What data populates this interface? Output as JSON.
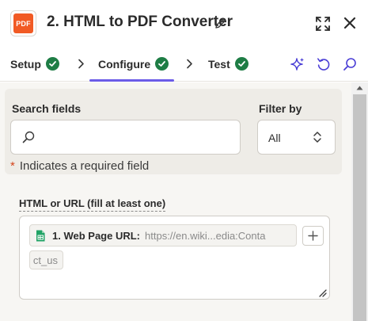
{
  "header": {
    "app_logo_text": "PDF",
    "title": "2. HTML to PDF Converter",
    "icons": [
      "edit-icon",
      "expand-icon",
      "close-icon"
    ]
  },
  "tabs": [
    {
      "label": "Setup",
      "status": "complete"
    },
    {
      "label": "Configure",
      "status": "complete",
      "active": true
    },
    {
      "label": "Test",
      "status": "complete"
    }
  ],
  "toolbar_icons": [
    "sparkle-icon",
    "undo-icon",
    "search-icon"
  ],
  "search_section": {
    "search_label": "Search fields",
    "search_value": "",
    "filter_label": "Filter by",
    "filter_value": "All",
    "required_marker": "*",
    "required_note": "Indicates a required field"
  },
  "field": {
    "label": "HTML or URL (fill at least one)",
    "pill_label": "1. Web Page URL:",
    "pill_value": "https://en.wiki...edia:Conta",
    "pill_value_wrap": "ct_us",
    "add_button": "+"
  },
  "colors": {
    "accent": "#6b5ce7",
    "check": "#1e7d45",
    "logo": "#f15a24",
    "sheets": "#21a366",
    "required": "#d4441c"
  }
}
